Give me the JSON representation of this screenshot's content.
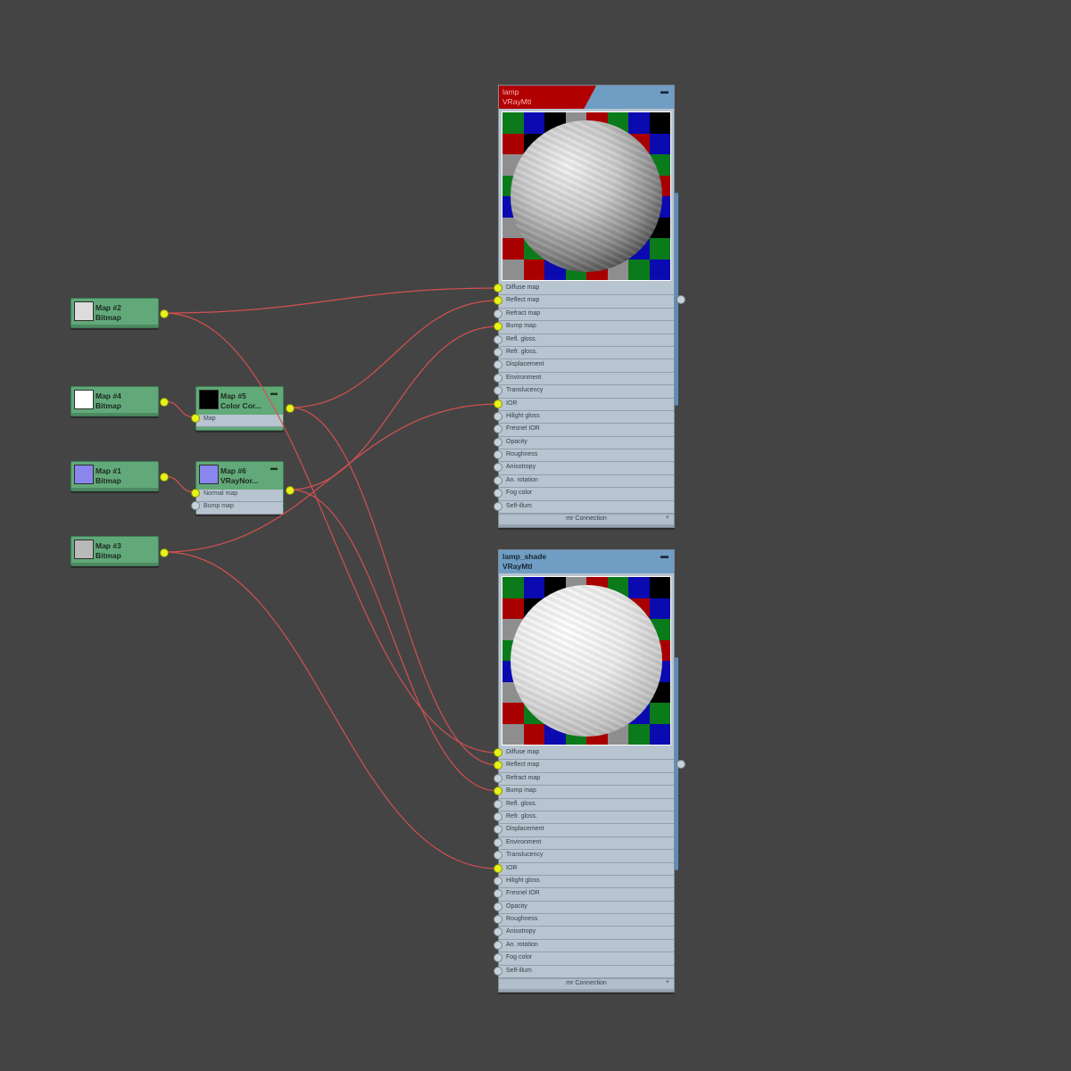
{
  "colors": {
    "wire": "#d45050",
    "socket_on": "#e6f21c",
    "socket_off": "#c9d2da",
    "map_node": "#62a979",
    "material_header": "#6f9dc3",
    "selected_header": "#b00000"
  },
  "map_nodes": [
    {
      "id": "map2",
      "line1": "Map #2",
      "line2": "Bitmap",
      "thumb": "#dcdcdc"
    },
    {
      "id": "map4",
      "line1": "Map #4",
      "line2": "Bitmap",
      "thumb": "#ffffff"
    },
    {
      "id": "map5",
      "line1": "Map #5",
      "line2": "Color Cor...",
      "thumb": "#000000",
      "inputs": [
        "Map"
      ]
    },
    {
      "id": "map1",
      "line1": "Map #1",
      "line2": "Bitmap",
      "thumb": "#8a86ee"
    },
    {
      "id": "map6",
      "line1": "Map #6",
      "line2": "VRayNor...",
      "thumb": "#8a86ee",
      "inputs": [
        "Normal map",
        "Bump map"
      ]
    },
    {
      "id": "map3",
      "line1": "Map #3",
      "line2": "Bitmap",
      "thumb": "#b9b9b9"
    }
  ],
  "materials": [
    {
      "id": "lamp",
      "name": "lamp",
      "type": "VRayMtl",
      "selected": true,
      "slots": [
        "Diffuse map",
        "Reflect map",
        "Refract map",
        "Bump map",
        "Refl. gloss.",
        "Refr. gloss.",
        "Displacement",
        "Environment",
        "Translucency",
        "IOR",
        "Hilight gloss",
        "Fresnel IOR",
        "Opacity",
        "Roughness",
        "Anisotropy",
        "An. rotation",
        "Fog color",
        "Self-illum"
      ],
      "connected": [
        0,
        1,
        3,
        9
      ],
      "footer": "mr Connection"
    },
    {
      "id": "lamp_shade",
      "name": "lamp_shade",
      "type": "VRayMtl",
      "selected": false,
      "slots": [
        "Diffuse map",
        "Reflect map",
        "Refract map",
        "Bump map",
        "Refl. gloss.",
        "Refr. gloss.",
        "Displacement",
        "Environment",
        "Translucency",
        "IOR",
        "Hilight gloss",
        "Fresnel IOR",
        "Opacity",
        "Roughness",
        "Anisotropy",
        "An. rotation",
        "Fog color",
        "Self-illum"
      ],
      "connected": [
        0,
        1,
        3,
        9
      ],
      "footer": "mr Connection"
    }
  ]
}
